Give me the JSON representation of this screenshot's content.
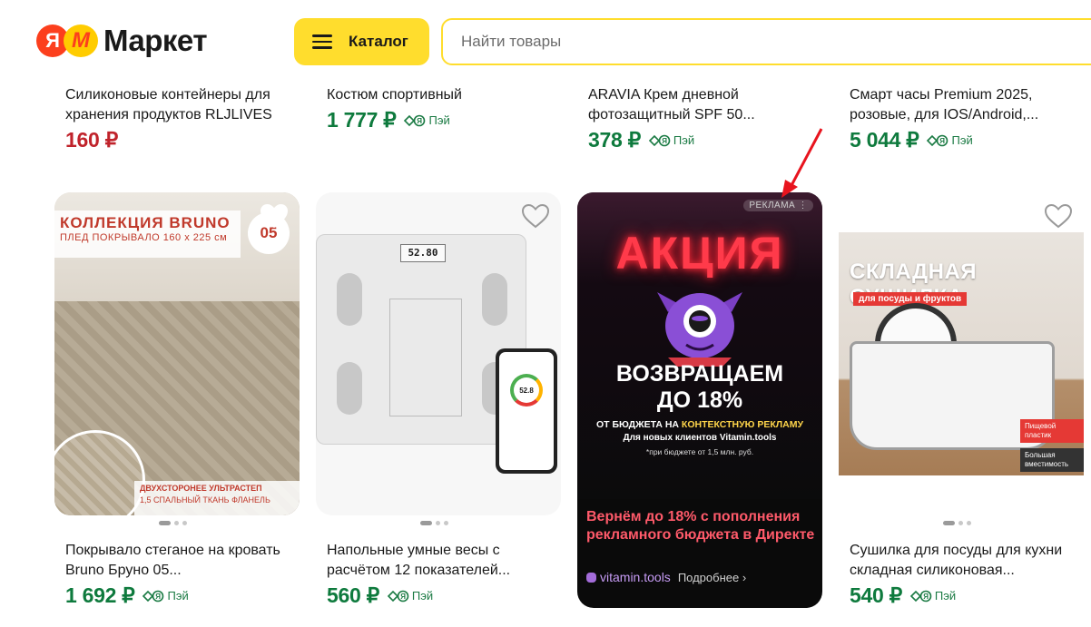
{
  "header": {
    "logo_ya": "Я",
    "logo_m": "M",
    "logo_text": "Маркет",
    "catalog_label": "Каталог",
    "search_placeholder": "Найти товары"
  },
  "colors": {
    "accent_yellow": "#ffdd2d",
    "price_green": "#0e7a3d",
    "price_red": "#c0232b",
    "ad_title": "#ff5a6a"
  },
  "pay_label": "Пэй",
  "top_products": [
    {
      "name": "Силиконовые контейнеры для хранения продуктов RLJLIVES",
      "price": "160 ₽",
      "has_pay": false
    },
    {
      "name": "Костюм спортивный",
      "price": "1 777 ₽",
      "has_pay": true
    },
    {
      "name": "ARAVIA Крем дневной фотозащитный SPF 50...",
      "price": "378 ₽",
      "has_pay": true
    },
    {
      "name": "Смарт часы Premium 2025, розовые, для IOS/Android,...",
      "price": "5 044 ₽",
      "has_pay": true
    }
  ],
  "products": [
    {
      "name": "Покрывало стеганое на кровать Bruno Бруно 05...",
      "price": "1 692 ₽",
      "image_text": {
        "title": "КОЛЛЕКЦИЯ  BRUNO",
        "subtitle": "ПЛЕД ПОКРЫВАЛО 160 х 225 см",
        "badge": "05",
        "foot1": "ДВУХСТОРОНЕЕ  УЛЬТРАСТЕП",
        "foot2": "1,5 СПАЛЬНЫЙ     ТКАНЬ ФЛАНЕЛЬ"
      }
    },
    {
      "name": "Напольные умные весы с расчётом 12 показателей...",
      "price": "560 ₽",
      "image_text": {
        "display": "52.80",
        "phone_value": "52.8"
      }
    },
    {
      "name": "Сушилка для посуды для кухни складная силиконовая...",
      "price": "540 ₽",
      "image_text": {
        "title": "СКЛАДНАЯ СУШИЛКА",
        "subtitle": "для посуды и фруктов",
        "tag1": "Пищевой пластик",
        "tag2": "Большая вместимость"
      }
    }
  ],
  "ad": {
    "label": "РЕКЛАМА ⋮",
    "headline": "АКЦИЯ",
    "line_big": "ВОЗВРАЩАЕМ",
    "line_big2": "ДО 18%",
    "line1_pre": "ОТ БЮДЖЕТА НА ",
    "line1_hl": "КОНТЕКСТНУЮ РЕКЛАМУ",
    "line2": "Для новых клиентов Vitamin.tools",
    "line3": "*при бюджете от 1,5 млн. руб.",
    "title": "Вернём до 18% с пополнения рекламного бюджета в Директе",
    "site": "vitamin.tools",
    "more": "Подробнее ›"
  }
}
